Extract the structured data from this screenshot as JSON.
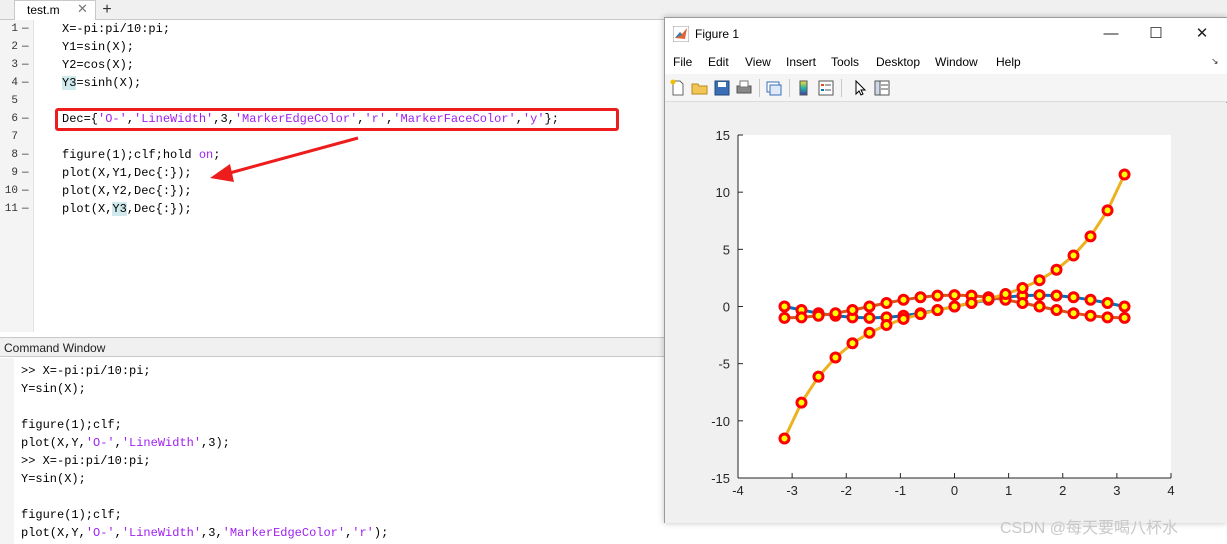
{
  "editor": {
    "tab": "test.m",
    "tab_close": "✕",
    "tab_add": "+",
    "line_numbers": [
      "1",
      "2",
      "3",
      "4",
      "5",
      "6",
      "7",
      "8",
      "9",
      "10",
      "11"
    ],
    "breakpoint_dash": "—",
    "lines": {
      "l1": "X=-pi:pi/10:pi;",
      "l2": "Y1=sin(X);",
      "l3": "Y2=cos(X);",
      "l4_var": "Y3",
      "l4_rest": "=sinh(X);",
      "l6_a": "Dec={",
      "l6_s1": "'O-'",
      "l6_c1": ",",
      "l6_s2": "'LineWidth'",
      "l6_c2": ",3,",
      "l6_s3": "'MarkerEdgeColor'",
      "l6_c3": ",",
      "l6_s4": "'r'",
      "l6_c4": ",",
      "l6_s5": "'MarkerFaceColor'",
      "l6_c5": ",",
      "l6_s6": "'y'",
      "l6_end": "};",
      "l8_a": "figure(1);clf;hold ",
      "l8_kw": "on",
      "l8_end": ";",
      "l9": "plot(X,Y1,Dec{:});",
      "l10": "plot(X,Y2,Dec{:});",
      "l11_a": "plot(X,",
      "l11_var": "Y3",
      "l11_end": ",Dec{:});"
    }
  },
  "command_window": {
    "title": "Command Window",
    "lines": {
      "c1": ">> X=-pi:pi/10:pi;",
      "c2": "Y=sin(X);",
      "c3": "figure(1);clf;",
      "c4_a": "plot(X,Y,",
      "c4_s1": "'O-'",
      "c4_c1": ",",
      "c4_s2": "'LineWidth'",
      "c4_end": ",3);",
      "c5": ">> X=-pi:pi/10:pi;",
      "c6": "Y=sin(X);",
      "c7": "figure(1);clf;",
      "c8_a": "plot(X,Y,",
      "c8_s1": "'O-'",
      "c8_c1": ",",
      "c8_s2": "'LineWidth'",
      "c8_c2": ",3,",
      "c8_s3": "'MarkerEdgeColor'",
      "c8_c3": ",",
      "c8_s4": "'r'",
      "c8_end": ");"
    }
  },
  "figure": {
    "title": "Figure 1",
    "menu": [
      "File",
      "Edit",
      "View",
      "Insert",
      "Tools",
      "Desktop",
      "Window",
      "Help"
    ],
    "toolbar_icons": [
      "new-figure-icon",
      "open-file-icon",
      "save-icon",
      "print-icon",
      "link-plot-icon",
      "insert-colorbar-icon",
      "insert-legend-icon",
      "edit-plot-icon",
      "property-inspector-icon"
    ],
    "window_buttons": {
      "minimize": "—",
      "maximize": "☐",
      "close": "✕"
    }
  },
  "chart_data": {
    "type": "line",
    "title": "",
    "xlabel": "",
    "ylabel": "",
    "xlim": [
      -4,
      4
    ],
    "ylim": [
      -15,
      15
    ],
    "xticks": [
      -4,
      -3,
      -2,
      -1,
      0,
      1,
      2,
      3,
      4
    ],
    "yticks": [
      -15,
      -10,
      -5,
      0,
      5,
      10,
      15
    ],
    "x": [
      -3.1416,
      -2.8274,
      -2.5133,
      -2.1991,
      -1.885,
      -1.5708,
      -1.2566,
      -0.9425,
      -0.6283,
      -0.3142,
      0,
      0.3142,
      0.6283,
      0.9425,
      1.2566,
      1.5708,
      1.885,
      2.1991,
      2.5133,
      2.8274,
      3.1416
    ],
    "marker": "o",
    "line_width": 3,
    "marker_edge_color": "#ff0000",
    "marker_face_color": "#ffff00",
    "series": [
      {
        "color": "#0072bd",
        "values": [
          0,
          -0.309,
          -0.588,
          -0.809,
          -0.951,
          -1,
          -0.951,
          -0.809,
          -0.588,
          -0.309,
          0,
          0.309,
          0.588,
          0.809,
          0.951,
          1,
          0.951,
          0.809,
          0.588,
          0.309,
          0
        ]
      },
      {
        "color": "#d95319",
        "values": [
          -1,
          -0.951,
          -0.809,
          -0.588,
          -0.309,
          0,
          0.309,
          0.588,
          0.809,
          0.951,
          1,
          0.951,
          0.809,
          0.588,
          0.309,
          0,
          -0.309,
          -0.588,
          -0.809,
          -0.951,
          -1
        ]
      },
      {
        "color": "#edb120",
        "values": [
          -11.549,
          -8.406,
          -6.132,
          -4.457,
          -3.217,
          -2.301,
          -1.614,
          -1.088,
          -0.67,
          -0.319,
          0,
          0.319,
          0.67,
          1.088,
          1.614,
          2.301,
          3.217,
          4.457,
          6.132,
          8.406,
          11.549
        ]
      }
    ],
    "grid": false
  },
  "watermark": "CSDN @每天要喝八杯水"
}
